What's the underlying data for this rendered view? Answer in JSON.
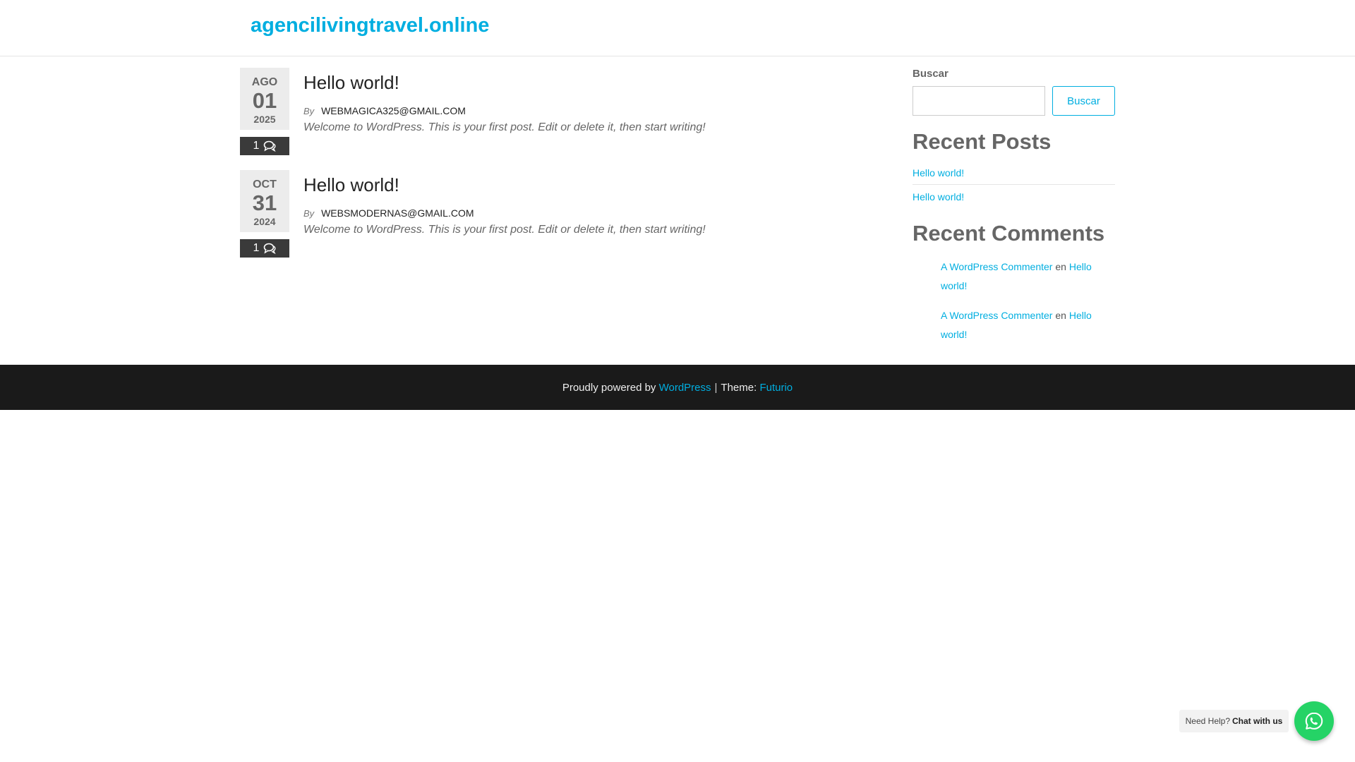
{
  "header": {
    "site_title": "agencilivingtravel.online"
  },
  "posts": [
    {
      "month": "AGO",
      "day": "01",
      "year": "2025",
      "comment_count": "1",
      "title": "Hello world!",
      "by_label": "By",
      "author": "WEBMAGICA325@GMAIL.COM",
      "excerpt": "Welcome to WordPress. This is your first post. Edit or delete it, then start writing!"
    },
    {
      "month": "OCT",
      "day": "31",
      "year": "2024",
      "comment_count": "1",
      "title": "Hello world!",
      "by_label": "By",
      "author": "WEBSMODERNAS@GMAIL.COM",
      "excerpt": "Welcome to WordPress. This is your first post. Edit or delete it, then start writing!"
    }
  ],
  "sidebar": {
    "search": {
      "label": "Buscar",
      "placeholder": "",
      "button_label": "Buscar"
    },
    "recent_posts": {
      "title": "Recent Posts",
      "items": [
        {
          "label": "Hello world!"
        },
        {
          "label": "Hello world!"
        }
      ]
    },
    "recent_comments": {
      "title": "Recent Comments",
      "items": [
        {
          "author": "A WordPress Commenter",
          "connector": "en",
          "post": "Hello world!"
        },
        {
          "author": "A WordPress Commenter",
          "connector": "en",
          "post": "Hello world!"
        }
      ]
    }
  },
  "footer": {
    "powered_text": "Proudly powered by",
    "powered_link": "WordPress",
    "separator": "|",
    "theme_text": "Theme:",
    "theme_link": "Futurio"
  },
  "chat_widget": {
    "help_text": "Need Help?",
    "chat_text": "Chat with us",
    "icon": "whatsapp-icon"
  },
  "colors": {
    "accent": "#00aee0",
    "footer_bg": "#1a1a1a",
    "chat_green": "#25d366"
  }
}
